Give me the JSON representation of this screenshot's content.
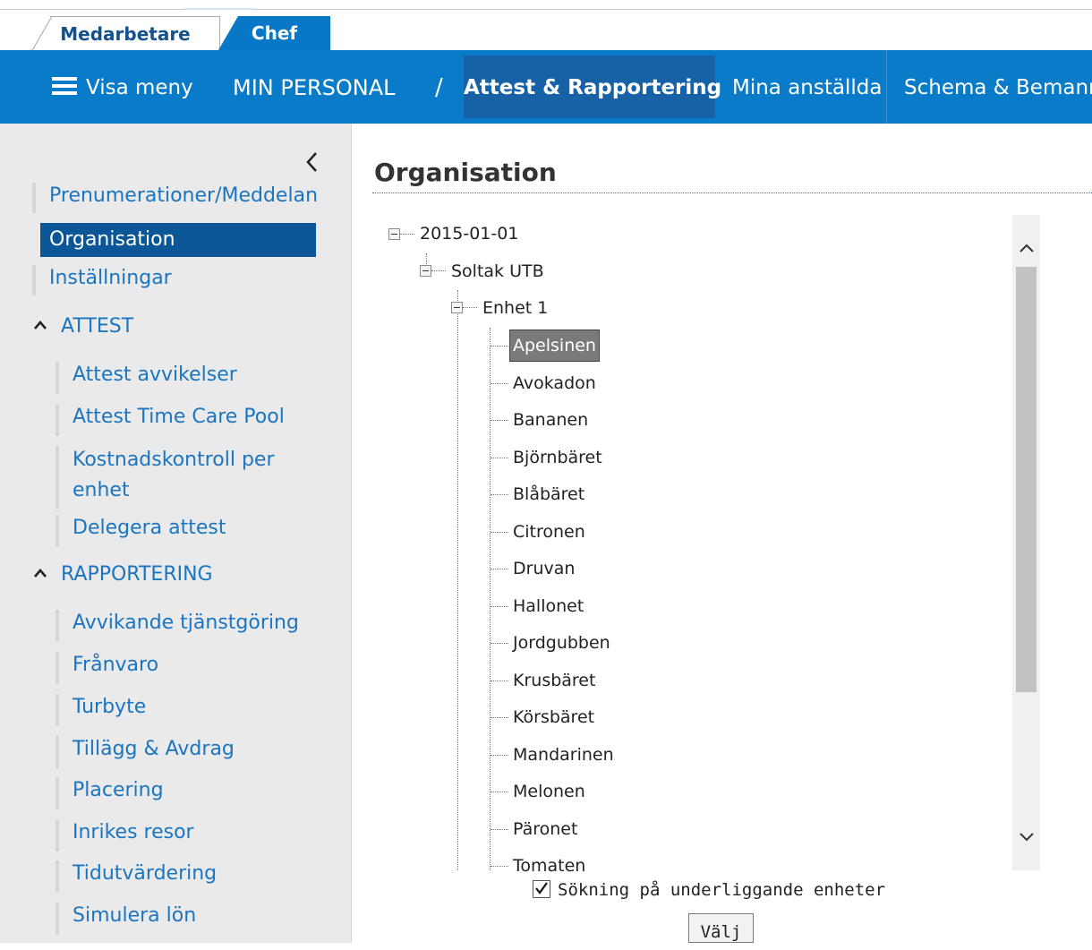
{
  "role_tabs": [
    {
      "label": "Medarbetare",
      "active": false
    },
    {
      "label": "Chef",
      "active": true
    }
  ],
  "nav": {
    "menu_label": "Visa meny",
    "section_label": "MIN PERSONAL",
    "separator": "/",
    "tabs": [
      {
        "label": "Attest & Rapportering",
        "active": true
      },
      {
        "label": "Mina anställda",
        "active": false
      },
      {
        "label": "Schema & Bemanni",
        "active": false
      }
    ]
  },
  "sidebar": {
    "items": [
      {
        "label": "Prenumerationer/Meddelan",
        "active": false
      },
      {
        "label": "Organisation",
        "active": true
      },
      {
        "label": "Inställningar",
        "active": false
      }
    ],
    "groups": [
      {
        "title": "ATTEST",
        "expanded": true,
        "items": [
          "Attest avvikelser",
          "Attest Time Care Pool",
          "Kostnadskontroll per",
          "enhet",
          "Delegera attest"
        ]
      },
      {
        "title": "RAPPORTERING",
        "expanded": true,
        "items": [
          "Avvikande tjänstgöring",
          "Frånvaro",
          "Turbyte",
          "Tillägg & Avdrag",
          "Placering",
          "Inrikes resor",
          "Tidutvärdering",
          "Simulera lön"
        ]
      }
    ]
  },
  "main": {
    "title": "Organisation",
    "tree": {
      "root": "2015-01-01",
      "level1": "Soltak UTB",
      "level2": "Enhet 1",
      "leaves": [
        "Apelsinen",
        "Avokadon",
        "Bananen",
        "Björnbäret",
        "Blåbäret",
        "Citronen",
        "Druvan",
        "Hallonet",
        "Jordgubben",
        "Krusbäret",
        "Körsbäret",
        "Mandarinen",
        "Melonen",
        "Päronet",
        "Tomaten"
      ],
      "selected": "Apelsinen"
    },
    "checkbox_label": "Sökning på underliggande enheter",
    "checkbox_checked": true,
    "select_button": "Välj"
  },
  "colors": {
    "nav_blue": "#0a7bc8",
    "nav_active": "#1762a7",
    "sidebar_active": "#0b5697",
    "link_blue": "#1b75c0",
    "sidebar_bg": "#eaeaea"
  },
  "icons": {
    "menu": "hamburger-icon",
    "collapse": "chevron-left-icon",
    "group_caret": "chevron-up-icon",
    "scroll_up": "chevron-up-icon",
    "scroll_down": "chevron-down-icon",
    "tree_toggle": "minus-box-icon",
    "checkbox": "checkmark-icon"
  }
}
